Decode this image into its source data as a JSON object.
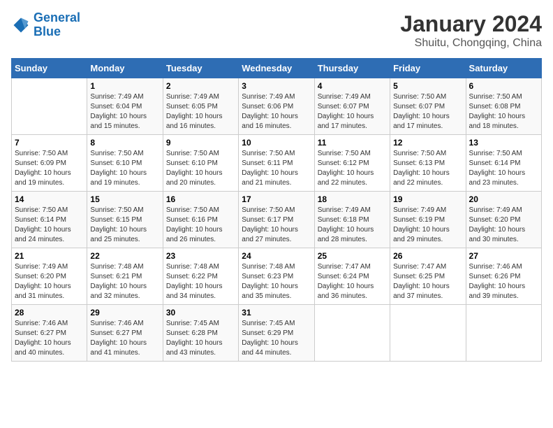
{
  "header": {
    "logo_line1": "General",
    "logo_line2": "Blue",
    "title": "January 2024",
    "subtitle": "Shuitu, Chongqing, China"
  },
  "weekdays": [
    "Sunday",
    "Monday",
    "Tuesday",
    "Wednesday",
    "Thursday",
    "Friday",
    "Saturday"
  ],
  "weeks": [
    [
      {
        "day": "",
        "sunrise": "",
        "sunset": "",
        "daylight": ""
      },
      {
        "day": "1",
        "sunrise": "Sunrise: 7:49 AM",
        "sunset": "Sunset: 6:04 PM",
        "daylight": "Daylight: 10 hours and 15 minutes."
      },
      {
        "day": "2",
        "sunrise": "Sunrise: 7:49 AM",
        "sunset": "Sunset: 6:05 PM",
        "daylight": "Daylight: 10 hours and 16 minutes."
      },
      {
        "day": "3",
        "sunrise": "Sunrise: 7:49 AM",
        "sunset": "Sunset: 6:06 PM",
        "daylight": "Daylight: 10 hours and 16 minutes."
      },
      {
        "day": "4",
        "sunrise": "Sunrise: 7:49 AM",
        "sunset": "Sunset: 6:07 PM",
        "daylight": "Daylight: 10 hours and 17 minutes."
      },
      {
        "day": "5",
        "sunrise": "Sunrise: 7:50 AM",
        "sunset": "Sunset: 6:07 PM",
        "daylight": "Daylight: 10 hours and 17 minutes."
      },
      {
        "day": "6",
        "sunrise": "Sunrise: 7:50 AM",
        "sunset": "Sunset: 6:08 PM",
        "daylight": "Daylight: 10 hours and 18 minutes."
      }
    ],
    [
      {
        "day": "7",
        "sunrise": "Sunrise: 7:50 AM",
        "sunset": "Sunset: 6:09 PM",
        "daylight": "Daylight: 10 hours and 19 minutes."
      },
      {
        "day": "8",
        "sunrise": "Sunrise: 7:50 AM",
        "sunset": "Sunset: 6:10 PM",
        "daylight": "Daylight: 10 hours and 19 minutes."
      },
      {
        "day": "9",
        "sunrise": "Sunrise: 7:50 AM",
        "sunset": "Sunset: 6:10 PM",
        "daylight": "Daylight: 10 hours and 20 minutes."
      },
      {
        "day": "10",
        "sunrise": "Sunrise: 7:50 AM",
        "sunset": "Sunset: 6:11 PM",
        "daylight": "Daylight: 10 hours and 21 minutes."
      },
      {
        "day": "11",
        "sunrise": "Sunrise: 7:50 AM",
        "sunset": "Sunset: 6:12 PM",
        "daylight": "Daylight: 10 hours and 22 minutes."
      },
      {
        "day": "12",
        "sunrise": "Sunrise: 7:50 AM",
        "sunset": "Sunset: 6:13 PM",
        "daylight": "Daylight: 10 hours and 22 minutes."
      },
      {
        "day": "13",
        "sunrise": "Sunrise: 7:50 AM",
        "sunset": "Sunset: 6:14 PM",
        "daylight": "Daylight: 10 hours and 23 minutes."
      }
    ],
    [
      {
        "day": "14",
        "sunrise": "Sunrise: 7:50 AM",
        "sunset": "Sunset: 6:14 PM",
        "daylight": "Daylight: 10 hours and 24 minutes."
      },
      {
        "day": "15",
        "sunrise": "Sunrise: 7:50 AM",
        "sunset": "Sunset: 6:15 PM",
        "daylight": "Daylight: 10 hours and 25 minutes."
      },
      {
        "day": "16",
        "sunrise": "Sunrise: 7:50 AM",
        "sunset": "Sunset: 6:16 PM",
        "daylight": "Daylight: 10 hours and 26 minutes."
      },
      {
        "day": "17",
        "sunrise": "Sunrise: 7:50 AM",
        "sunset": "Sunset: 6:17 PM",
        "daylight": "Daylight: 10 hours and 27 minutes."
      },
      {
        "day": "18",
        "sunrise": "Sunrise: 7:49 AM",
        "sunset": "Sunset: 6:18 PM",
        "daylight": "Daylight: 10 hours and 28 minutes."
      },
      {
        "day": "19",
        "sunrise": "Sunrise: 7:49 AM",
        "sunset": "Sunset: 6:19 PM",
        "daylight": "Daylight: 10 hours and 29 minutes."
      },
      {
        "day": "20",
        "sunrise": "Sunrise: 7:49 AM",
        "sunset": "Sunset: 6:20 PM",
        "daylight": "Daylight: 10 hours and 30 minutes."
      }
    ],
    [
      {
        "day": "21",
        "sunrise": "Sunrise: 7:49 AM",
        "sunset": "Sunset: 6:20 PM",
        "daylight": "Daylight: 10 hours and 31 minutes."
      },
      {
        "day": "22",
        "sunrise": "Sunrise: 7:48 AM",
        "sunset": "Sunset: 6:21 PM",
        "daylight": "Daylight: 10 hours and 32 minutes."
      },
      {
        "day": "23",
        "sunrise": "Sunrise: 7:48 AM",
        "sunset": "Sunset: 6:22 PM",
        "daylight": "Daylight: 10 hours and 34 minutes."
      },
      {
        "day": "24",
        "sunrise": "Sunrise: 7:48 AM",
        "sunset": "Sunset: 6:23 PM",
        "daylight": "Daylight: 10 hours and 35 minutes."
      },
      {
        "day": "25",
        "sunrise": "Sunrise: 7:47 AM",
        "sunset": "Sunset: 6:24 PM",
        "daylight": "Daylight: 10 hours and 36 minutes."
      },
      {
        "day": "26",
        "sunrise": "Sunrise: 7:47 AM",
        "sunset": "Sunset: 6:25 PM",
        "daylight": "Daylight: 10 hours and 37 minutes."
      },
      {
        "day": "27",
        "sunrise": "Sunrise: 7:46 AM",
        "sunset": "Sunset: 6:26 PM",
        "daylight": "Daylight: 10 hours and 39 minutes."
      }
    ],
    [
      {
        "day": "28",
        "sunrise": "Sunrise: 7:46 AM",
        "sunset": "Sunset: 6:27 PM",
        "daylight": "Daylight: 10 hours and 40 minutes."
      },
      {
        "day": "29",
        "sunrise": "Sunrise: 7:46 AM",
        "sunset": "Sunset: 6:27 PM",
        "daylight": "Daylight: 10 hours and 41 minutes."
      },
      {
        "day": "30",
        "sunrise": "Sunrise: 7:45 AM",
        "sunset": "Sunset: 6:28 PM",
        "daylight": "Daylight: 10 hours and 43 minutes."
      },
      {
        "day": "31",
        "sunrise": "Sunrise: 7:45 AM",
        "sunset": "Sunset: 6:29 PM",
        "daylight": "Daylight: 10 hours and 44 minutes."
      },
      {
        "day": "",
        "sunrise": "",
        "sunset": "",
        "daylight": ""
      },
      {
        "day": "",
        "sunrise": "",
        "sunset": "",
        "daylight": ""
      },
      {
        "day": "",
        "sunrise": "",
        "sunset": "",
        "daylight": ""
      }
    ]
  ]
}
